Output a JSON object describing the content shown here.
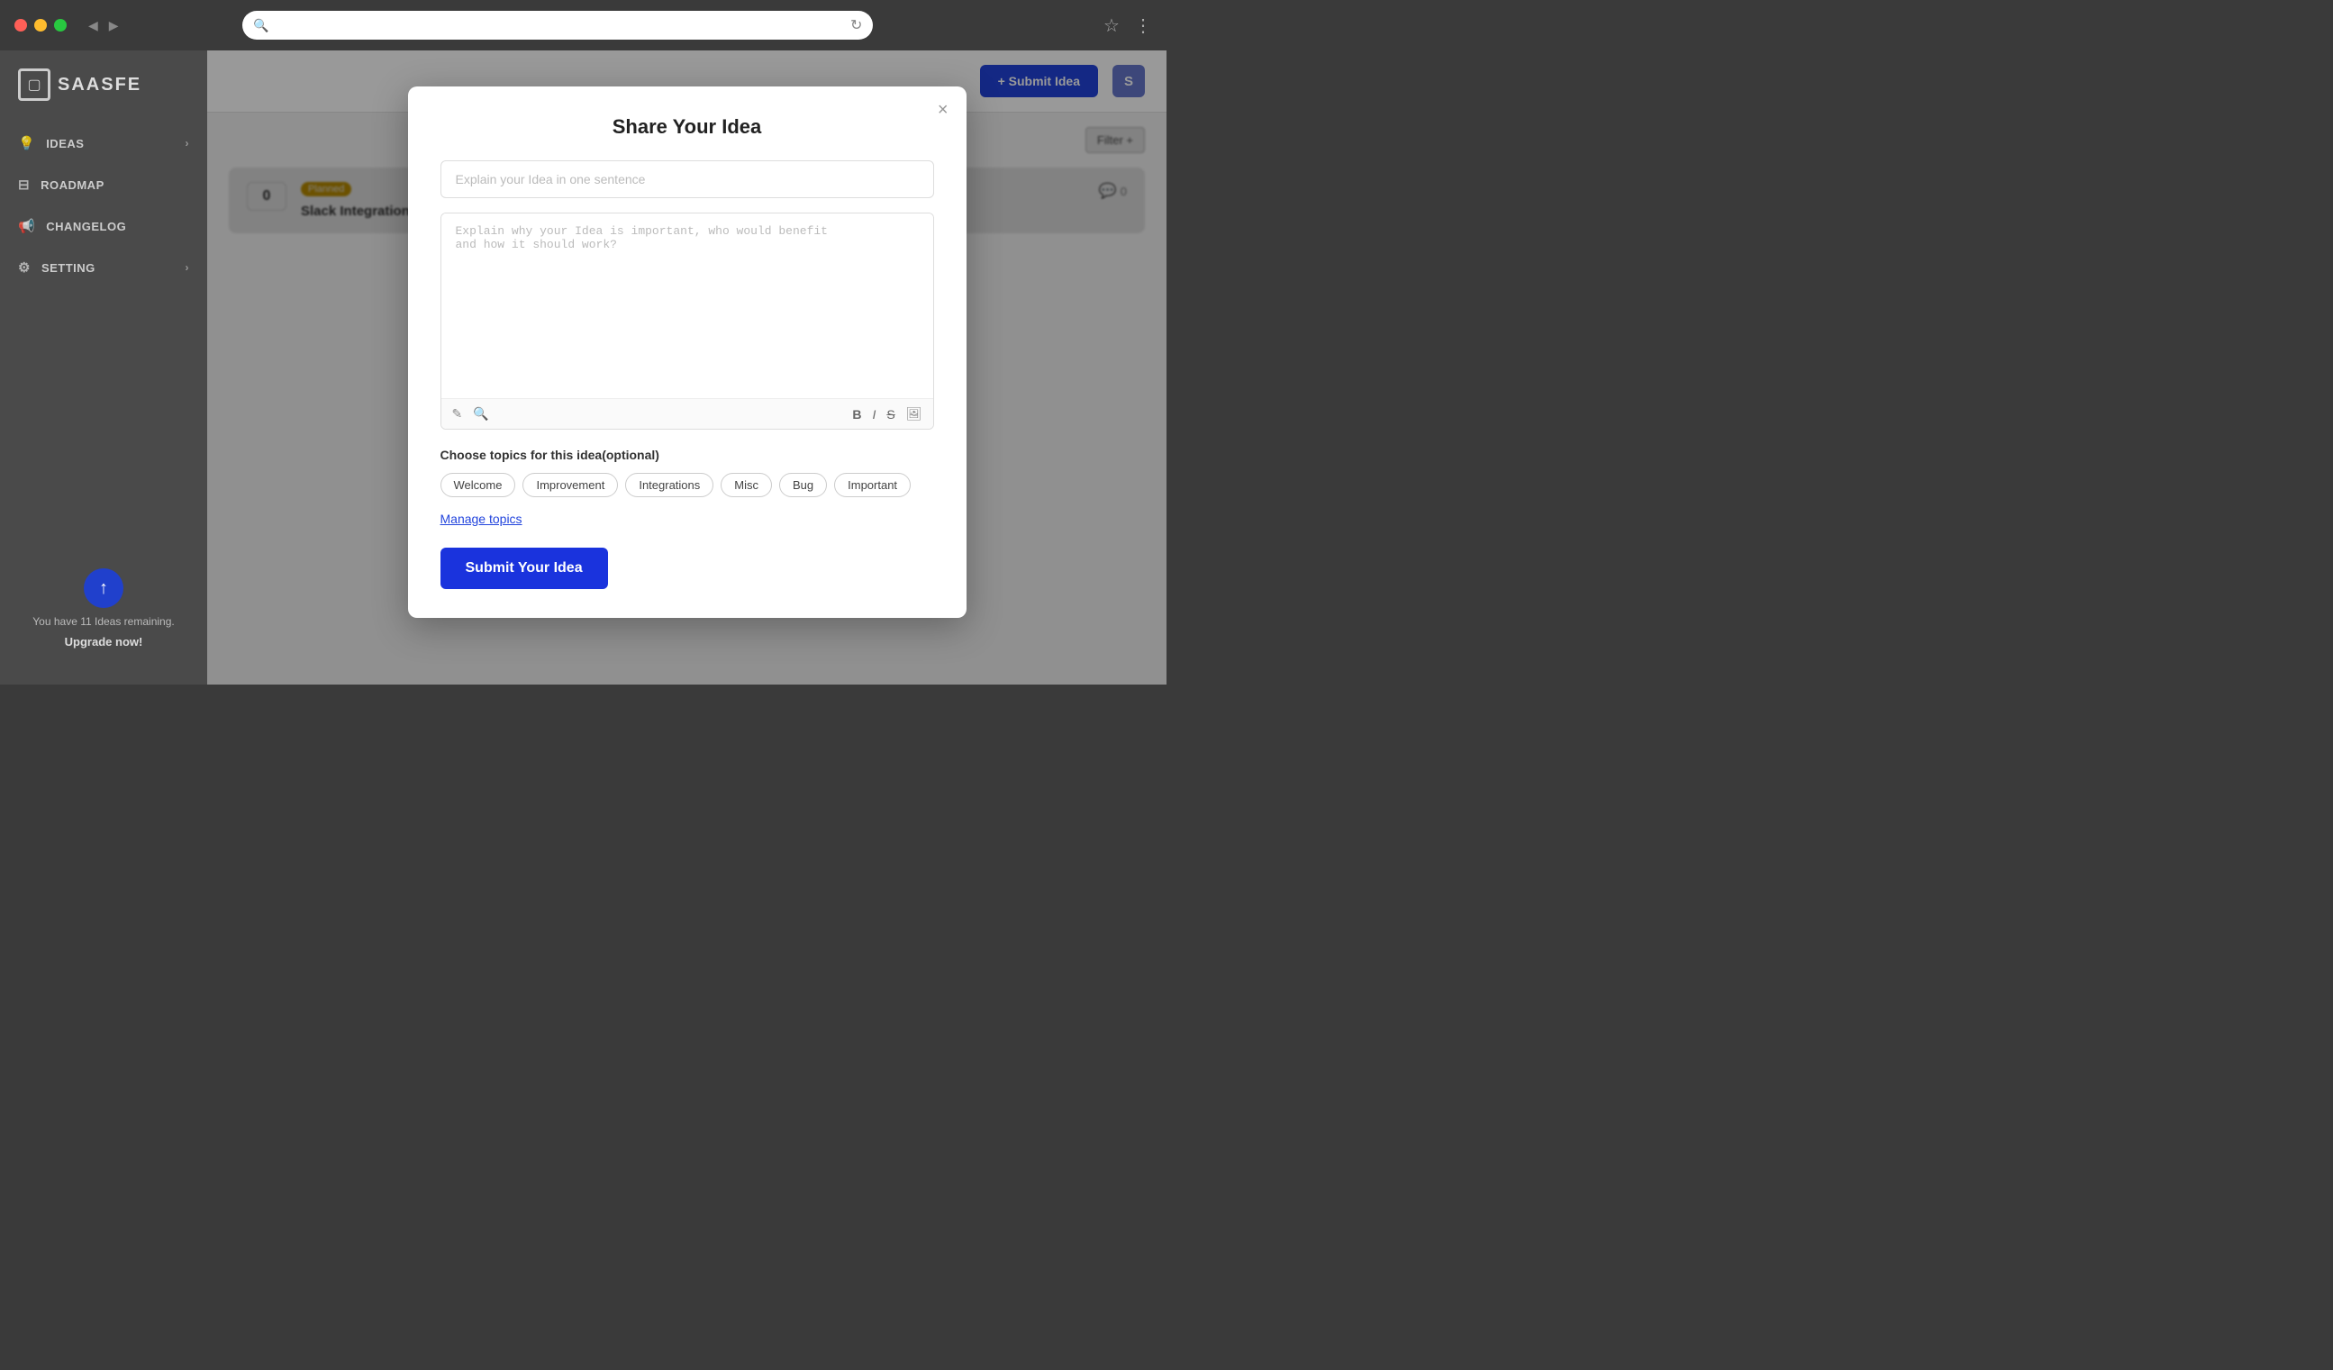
{
  "titlebar": {
    "url_placeholder": ""
  },
  "sidebar": {
    "logo_text": "SAASFE",
    "nav_items": [
      {
        "label": "IDEAS",
        "icon": "💡",
        "has_chevron": true
      },
      {
        "label": "ROADMAP",
        "icon": "⊟",
        "has_chevron": false
      },
      {
        "label": "CHANGELOG",
        "icon": "📢",
        "has_chevron": false
      },
      {
        "label": "SETTING",
        "icon": "⚙",
        "has_chevron": true
      }
    ],
    "upgrade_text": "You have 11 Ideas remaining.",
    "upgrade_link": "Upgrade now!"
  },
  "header": {
    "submit_btn_label": "+ Submit Idea",
    "user_initial": "S"
  },
  "filter": {
    "label": "Filter +"
  },
  "ideas": [
    {
      "vote": "0",
      "title": "Slack Integration",
      "status": "Planned",
      "comments": "0"
    }
  ],
  "modal": {
    "title": "Share Your Idea",
    "close_label": "×",
    "idea_input_placeholder": "Explain your Idea in one sentence",
    "idea_textarea_placeholder": "Explain why your Idea is important, who would benefit\nand how it should work?",
    "topics_label": "Choose topics for this idea(optional)",
    "topics": [
      "Welcome",
      "Improvement",
      "Integrations",
      "Misc",
      "Bug",
      "Important"
    ],
    "manage_topics_label": "Manage topics",
    "submit_label": "Submit Your Idea"
  }
}
